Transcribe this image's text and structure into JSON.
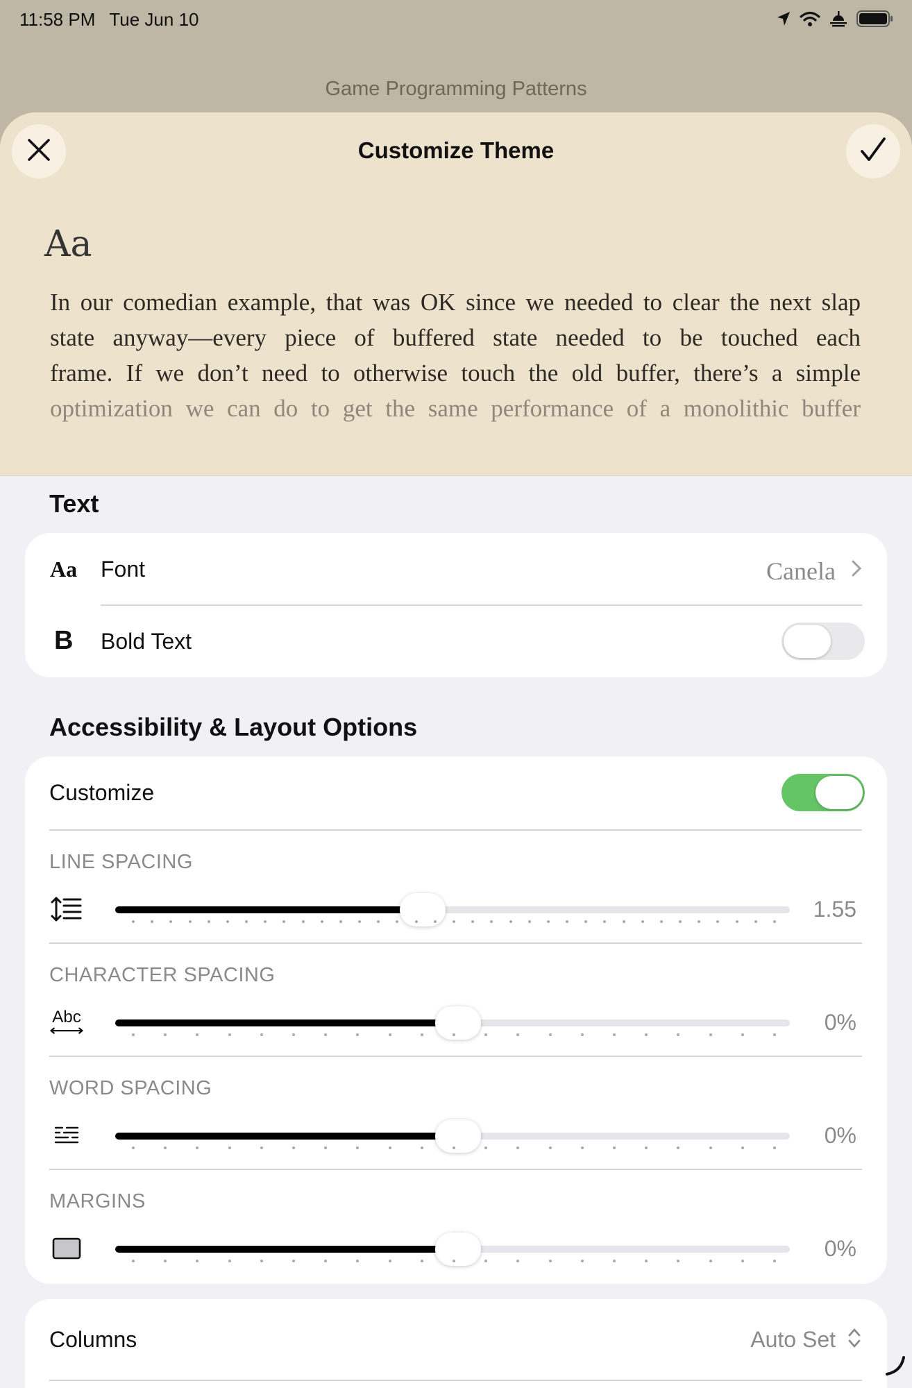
{
  "status_bar": {
    "time": "11:58 PM",
    "date": "Tue Jun 10",
    "icons": [
      "location-arrow-icon",
      "wifi-icon",
      "sleep-mode-icon",
      "battery-icon"
    ]
  },
  "book_title": "Game Programming Patterns",
  "sheet": {
    "title": "Customize Theme",
    "close_icon": "close-icon",
    "done_icon": "checkmark-icon"
  },
  "preview": {
    "aa": "Aa",
    "lines": [
      "In our comedian example, that was OK since we needed to clear the next slap",
      "state anyway—every piece of buffered state needed to be touched each",
      "frame. If we don’t need to otherwise touch the old buffer, there’s a simple",
      "optimization we can do to get the same performance of a monolithic buffer"
    ]
  },
  "text_section": {
    "heading": "Text",
    "font_icon_text": "Aa",
    "font_label": "Font",
    "font_value": "Canela",
    "bold_icon_text": "B",
    "bold_label": "Bold Text",
    "bold_on": false
  },
  "layout_section": {
    "heading": "Accessibility & Layout Options",
    "customize_label": "Customize",
    "customize_on": true,
    "sliders": [
      {
        "caption": "LINE SPACING",
        "value": "1.55",
        "level": 0.444,
        "icon": "line-spacing-icon"
      },
      {
        "caption": "CHARACTER SPACING",
        "value": "0%",
        "level": 0.5,
        "icon": "character-spacing-icon"
      },
      {
        "caption": "WORD SPACING",
        "value": "0%",
        "level": 0.5,
        "icon": "word-spacing-icon"
      },
      {
        "caption": "MARGINS",
        "value": "0%",
        "level": 0.5,
        "icon": "margins-icon"
      }
    ]
  },
  "columns": {
    "label": "Columns",
    "value": "Auto Set"
  },
  "colors": {
    "accent_green": "#65c466",
    "preview_bg": "#ede2cc",
    "sheet_bg": "#f1f0f5"
  }
}
